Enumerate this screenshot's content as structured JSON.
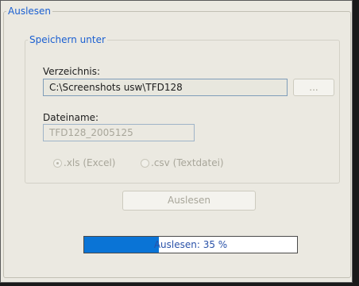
{
  "group_title": "Auslesen",
  "save_group": {
    "title": "Speichern unter",
    "directory_label": "Verzeichnis:",
    "directory_value": "C:\\Screenshots usw\\TFD128",
    "browse_label": "...",
    "filename_label": "Dateiname:",
    "filename_value": "TFD128_2005125",
    "format_options": [
      {
        "label": ".xls (Excel)",
        "selected": true
      },
      {
        "label": ".csv (Textdatei)",
        "selected": false
      }
    ]
  },
  "read_button_label": "Auslesen",
  "progress": {
    "text": "Auslesen: 35 %",
    "percent": 35,
    "fill_color": "#0a74d6"
  }
}
